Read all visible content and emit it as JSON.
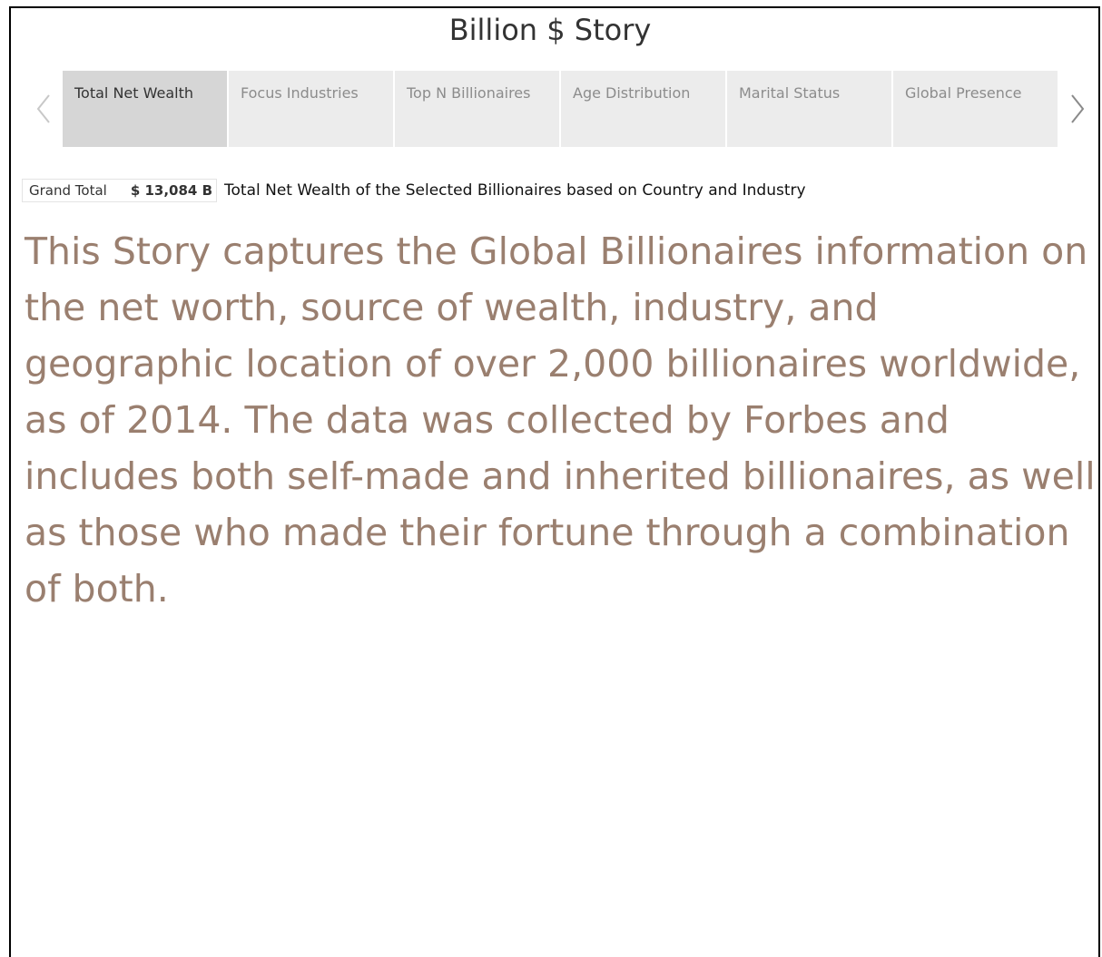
{
  "story": {
    "title": "Billion $ Story"
  },
  "navigation": {
    "prev_icon": "chevron-left-icon",
    "next_icon": "chevron-right-icon"
  },
  "tabs": [
    {
      "label": "Total Net Wealth",
      "active": true
    },
    {
      "label": "Focus Industries",
      "active": false
    },
    {
      "label": "Top N Billionaires",
      "active": false
    },
    {
      "label": "Age Distribution",
      "active": false
    },
    {
      "label": "Marital Status",
      "active": false
    },
    {
      "label": "Global Presence",
      "active": false
    }
  ],
  "summary": {
    "grand_total_label": "Grand Total",
    "grand_total_value": "$ 13,084 B",
    "caption": "Total Net Wealth of the Selected Billionaires based on Country and Industry"
  },
  "body": {
    "text": "This Story captures the Global Billionaires information on the net worth, source of wealth, industry, and geographic location of over 2,000 billionaires worldwide, as of 2014. The data was collected by Forbes and includes both self-made and inherited billionaires, as well as those who made their fortune through a combination of both."
  },
  "colors": {
    "tab_active_bg": "#d6d6d6",
    "tab_bg": "#ececec",
    "tab_text": "#8c8c8c",
    "body_text": "#9a7f6f",
    "title_text": "#333333"
  }
}
